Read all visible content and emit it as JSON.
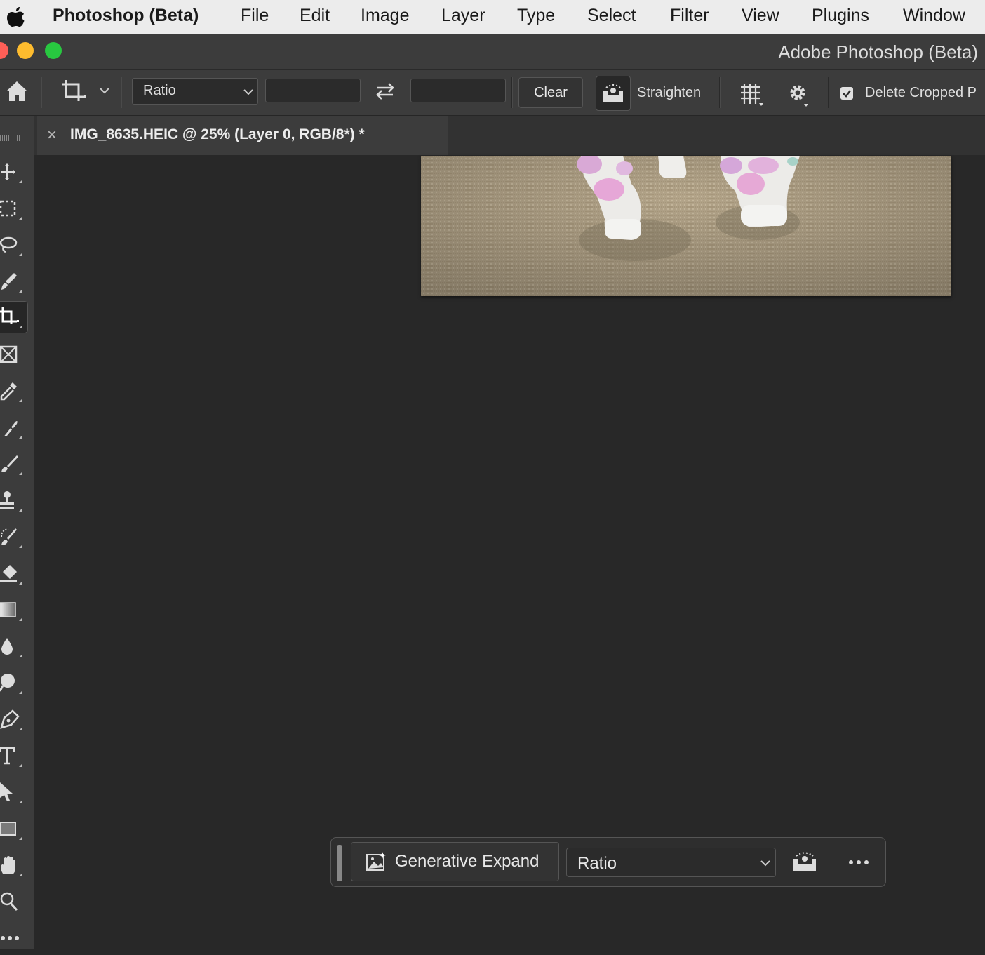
{
  "menubar": {
    "app_name": "Photoshop (Beta)",
    "items": [
      "File",
      "Edit",
      "Image",
      "Layer",
      "Type",
      "Select",
      "Filter",
      "View",
      "Plugins",
      "Window"
    ]
  },
  "window": {
    "title": "Adobe Photoshop (Beta)"
  },
  "options_bar": {
    "ratio_select": "Ratio",
    "width_value": "",
    "height_value": "",
    "clear_label": "Clear",
    "straighten_label": "Straighten",
    "delete_cropped_label": "Delete Cropped P",
    "delete_cropped_checked": true
  },
  "document_tab": {
    "close_glyph": "×",
    "title": "IMG_8635.HEIC @ 25% (Layer 0, RGB/8*) *"
  },
  "toolbar": {
    "tools": [
      "move-tool",
      "marquee-tool",
      "lasso-tool",
      "quick-selection-tool",
      "crop-tool",
      "frame-tool",
      "eyedropper-tool",
      "healing-brush-tool",
      "brush-tool",
      "clone-stamp-tool",
      "history-brush-tool",
      "eraser-tool",
      "gradient-tool",
      "blur-tool",
      "dodge-tool",
      "pen-tool",
      "type-tool",
      "path-selection-tool",
      "rectangle-tool",
      "hand-tool",
      "zoom-tool",
      "more-tools"
    ],
    "active_tool": "crop-tool"
  },
  "contextual_task_bar": {
    "generative_expand_label": "Generative Expand",
    "ratio_select": "Ratio"
  },
  "colors": {
    "canvas_bg": "#282828",
    "panel_bg": "#3c3c3c",
    "menubar_bg": "#ececec",
    "traffic_red": "#fe5f57",
    "traffic_yellow": "#febc2e",
    "traffic_green": "#28c840"
  }
}
